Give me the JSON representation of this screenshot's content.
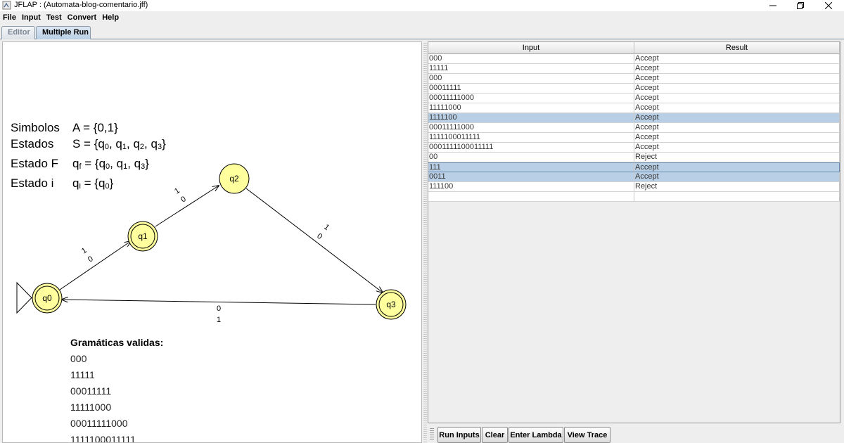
{
  "window": {
    "title": "JFLAP : (Automata-blog-comentario.jff)"
  },
  "menu": [
    "File",
    "Input",
    "Test",
    "Convert",
    "Help"
  ],
  "tabs": [
    "Editor",
    "Multiple Run"
  ],
  "legend": [
    {
      "label": "Simbolos",
      "value": "A = {0,1}"
    },
    {
      "label": "Estados",
      "value": "S = {q0, q1, q2, q3}"
    },
    {
      "label": "Estado F",
      "value": "qf = {q0, q1, q3}"
    },
    {
      "label": "Estado i",
      "value": "qi = {q0}"
    }
  ],
  "automaton": {
    "states": [
      {
        "id": "q0",
        "initial": true,
        "final": true
      },
      {
        "id": "q1",
        "initial": false,
        "final": true
      },
      {
        "id": "q2",
        "initial": false,
        "final": false
      },
      {
        "id": "q3",
        "initial": false,
        "final": true
      }
    ],
    "transitions": [
      {
        "from": "q0",
        "to": "q1",
        "labels": [
          "1",
          "0"
        ]
      },
      {
        "from": "q1",
        "to": "q2",
        "labels": [
          "1",
          "0"
        ]
      },
      {
        "from": "q2",
        "to": "q3",
        "labels": [
          "1",
          "0"
        ]
      },
      {
        "from": "q3",
        "to": "q0",
        "labels": [
          "0",
          "1"
        ]
      }
    ],
    "state_fill": "#ffff9e",
    "state_stroke": "#000000"
  },
  "grammar": {
    "title": "Gramáticas validas:",
    "items": [
      "000",
      "11111",
      "00011111",
      "11111000",
      "00011111000",
      "1111100011111"
    ]
  },
  "table": {
    "headers": [
      "Input",
      "Result"
    ],
    "rows": [
      {
        "input": "000",
        "result": "Accept"
      },
      {
        "input": "11111",
        "result": "Accept"
      },
      {
        "input": "000",
        "result": "Accept"
      },
      {
        "input": "00011111",
        "result": "Accept"
      },
      {
        "input": "00011111000",
        "result": "Accept"
      },
      {
        "input": "11111000",
        "result": "Accept"
      },
      {
        "input": "1111100",
        "result": "Accept",
        "selected": true
      },
      {
        "input": "00011111000",
        "result": "Accept"
      },
      {
        "input": "1111100011111",
        "result": "Accept"
      },
      {
        "input": "0001111100011111",
        "result": "Accept"
      },
      {
        "input": "00",
        "result": "Reject"
      },
      {
        "input": "111",
        "result": "Accept",
        "selected": true,
        "focused": true
      },
      {
        "input": "0011",
        "result": "Accept",
        "selected": true
      },
      {
        "input": "111100",
        "result": "Reject"
      },
      {
        "input": "",
        "result": ""
      }
    ],
    "selection_color": "#b8cfe5"
  },
  "buttons": {
    "run": "Run Inputs",
    "clear": "Clear",
    "lambda": "Enter Lambda",
    "trace": "View Trace"
  }
}
